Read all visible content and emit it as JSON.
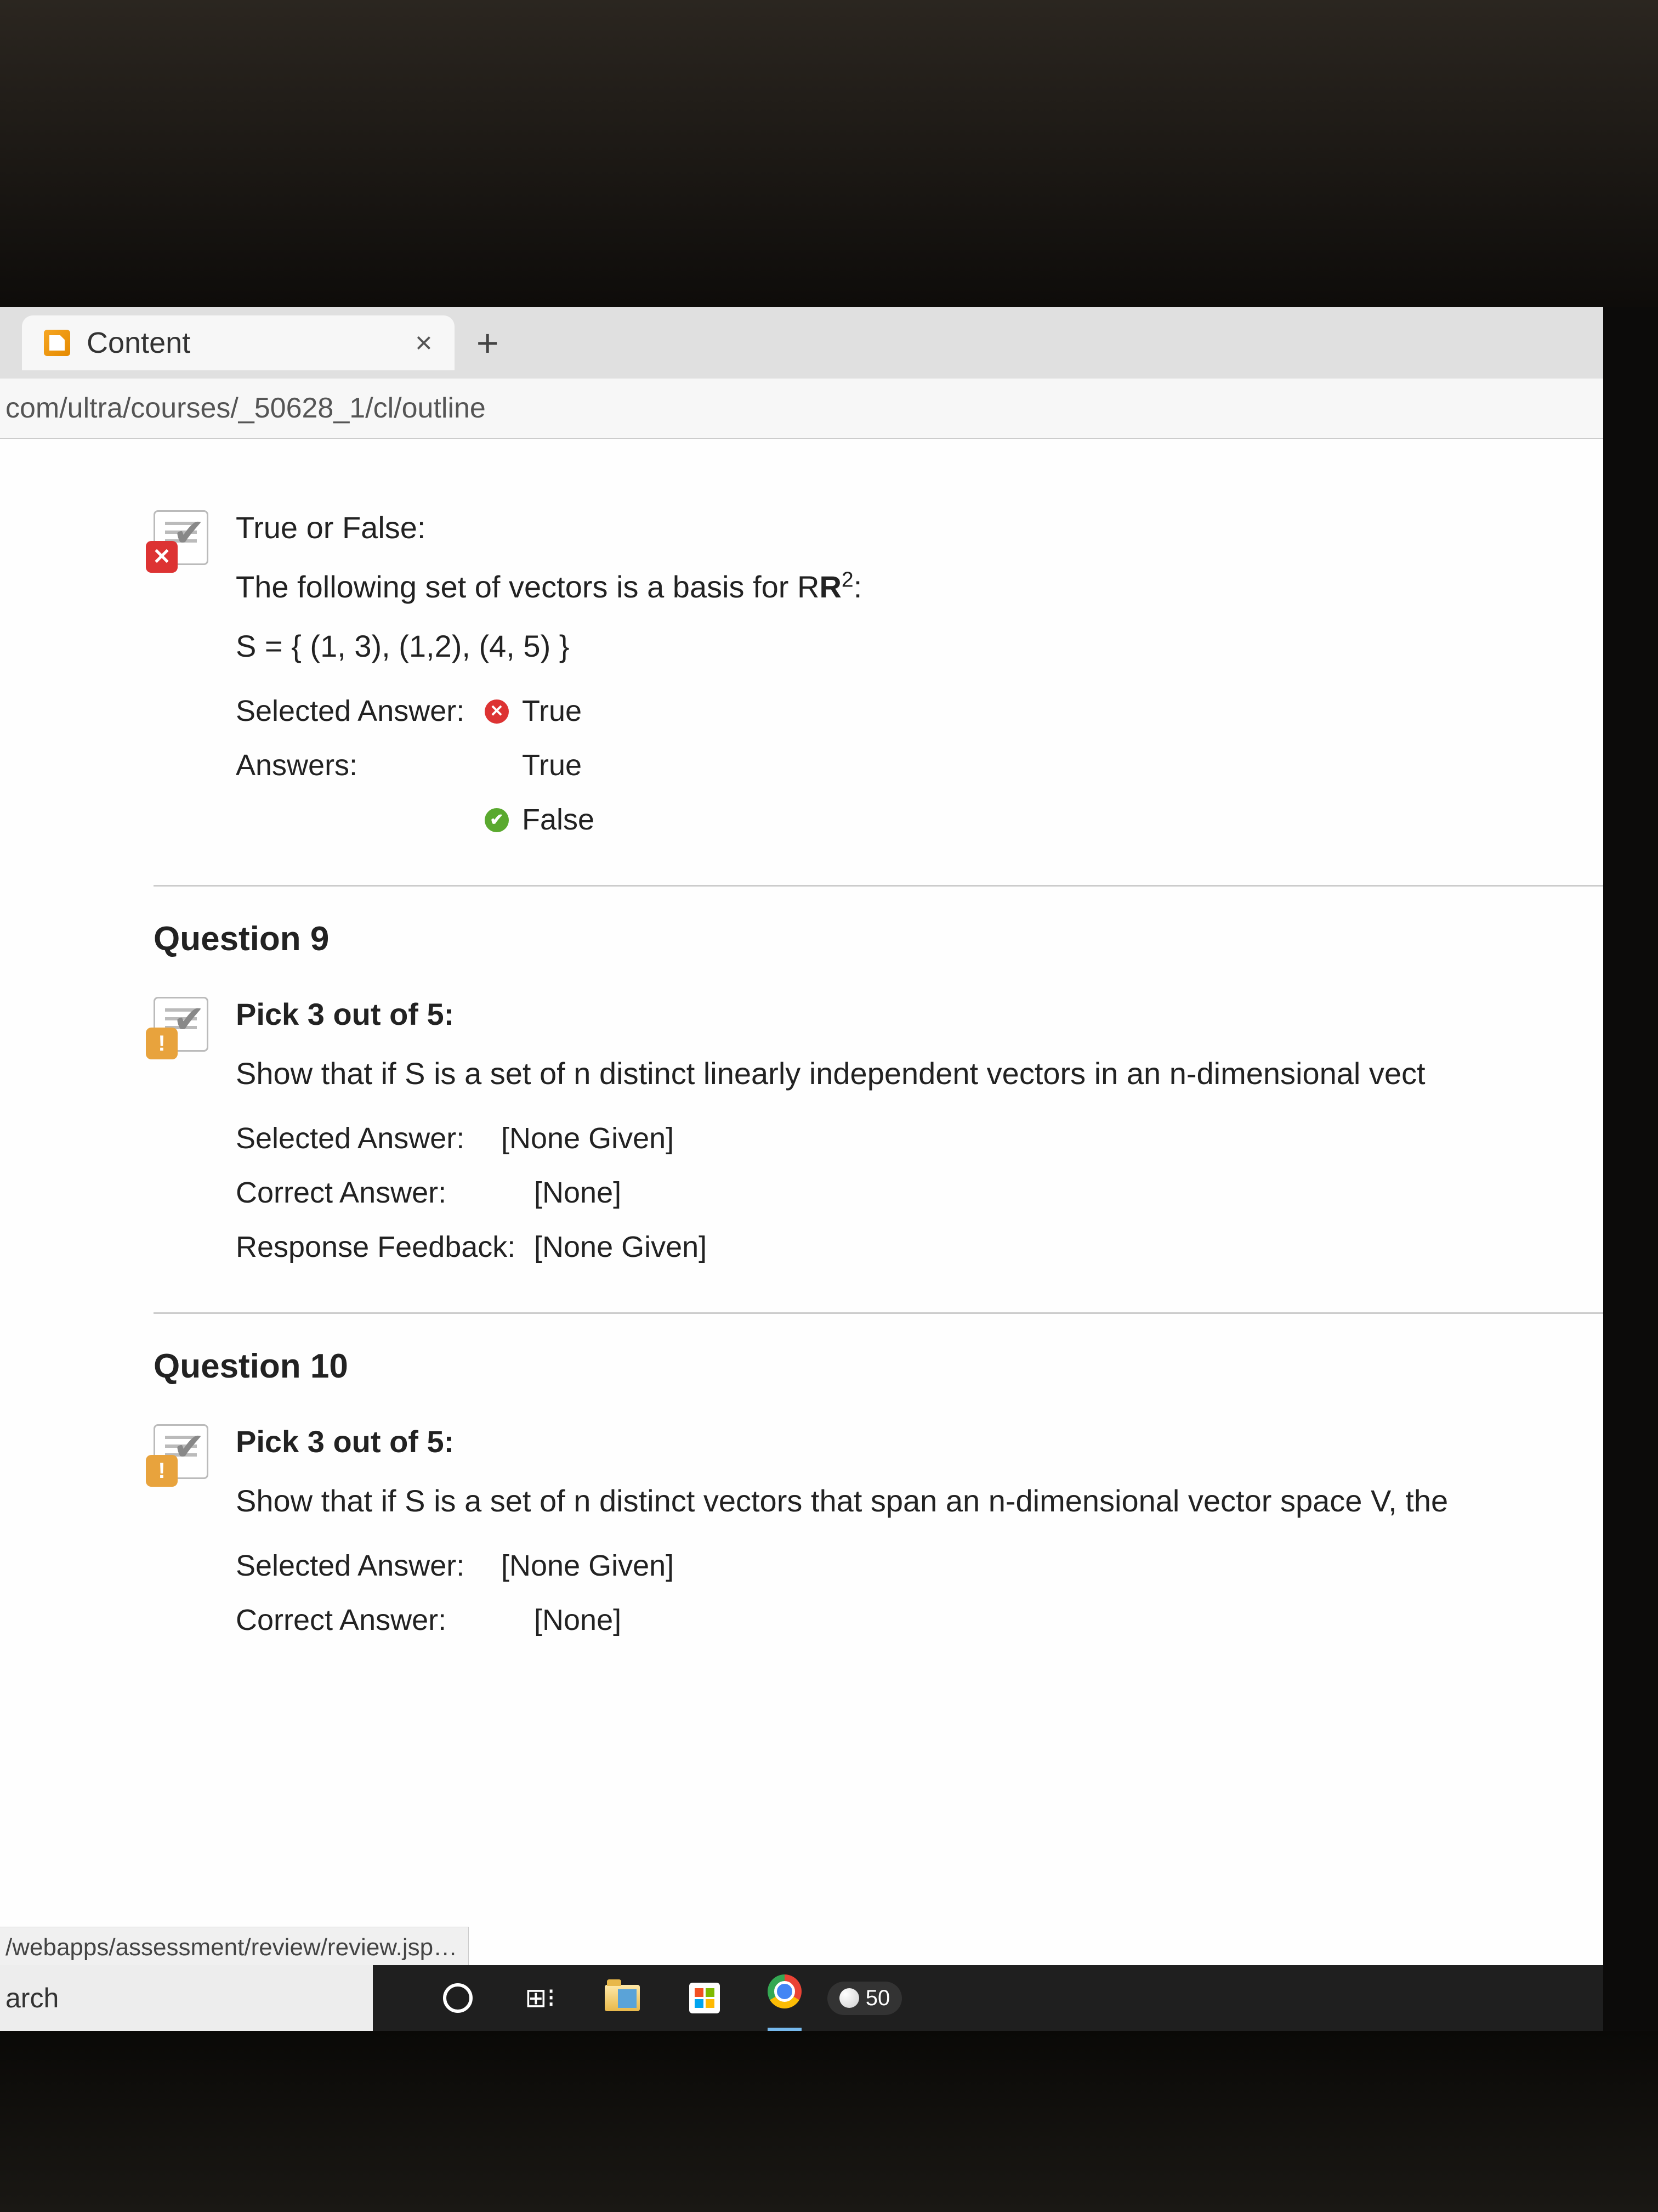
{
  "browser": {
    "tab_title": "Content",
    "url_visible": "com/ultra/courses/_50628_1/cl/outline",
    "status_text": "/webapps/assessment/review/review.jsp…"
  },
  "question8": {
    "prompt_label": "True or False:",
    "prompt_line1": "The following set of vectors is a basis for R",
    "prompt_sup": "2",
    "prompt_tail": ":",
    "set_line": "S = { (1, 3), (1,2), (4, 5) }",
    "selected_label": "Selected Answer:",
    "selected_value": "True",
    "answers_label": "Answers:",
    "answer_true": "True",
    "answer_false": "False"
  },
  "question9": {
    "header": "Question 9",
    "prompt_label": "Pick 3 out of 5:",
    "prompt_text": "Show that if S is a set of n distinct linearly independent vectors in an n-dimensional vect",
    "selected_label": "Selected Answer:",
    "selected_value": "[None Given]",
    "correct_label": "Correct Answer:",
    "correct_value": "[None]",
    "feedback_label": "Response Feedback:",
    "feedback_value": "[None Given]"
  },
  "question10": {
    "header": "Question 10",
    "prompt_label": "Pick 3 out of 5:",
    "prompt_text": "Show that if S is a set of n distinct vectors that span an n-dimensional vector space V, the",
    "selected_label": "Selected Answer:",
    "selected_value": "[None Given]",
    "correct_label_partial": "Correct Answer:",
    "correct_value": "[None]"
  },
  "taskbar": {
    "search_visible": "arch",
    "temperature": "50"
  }
}
